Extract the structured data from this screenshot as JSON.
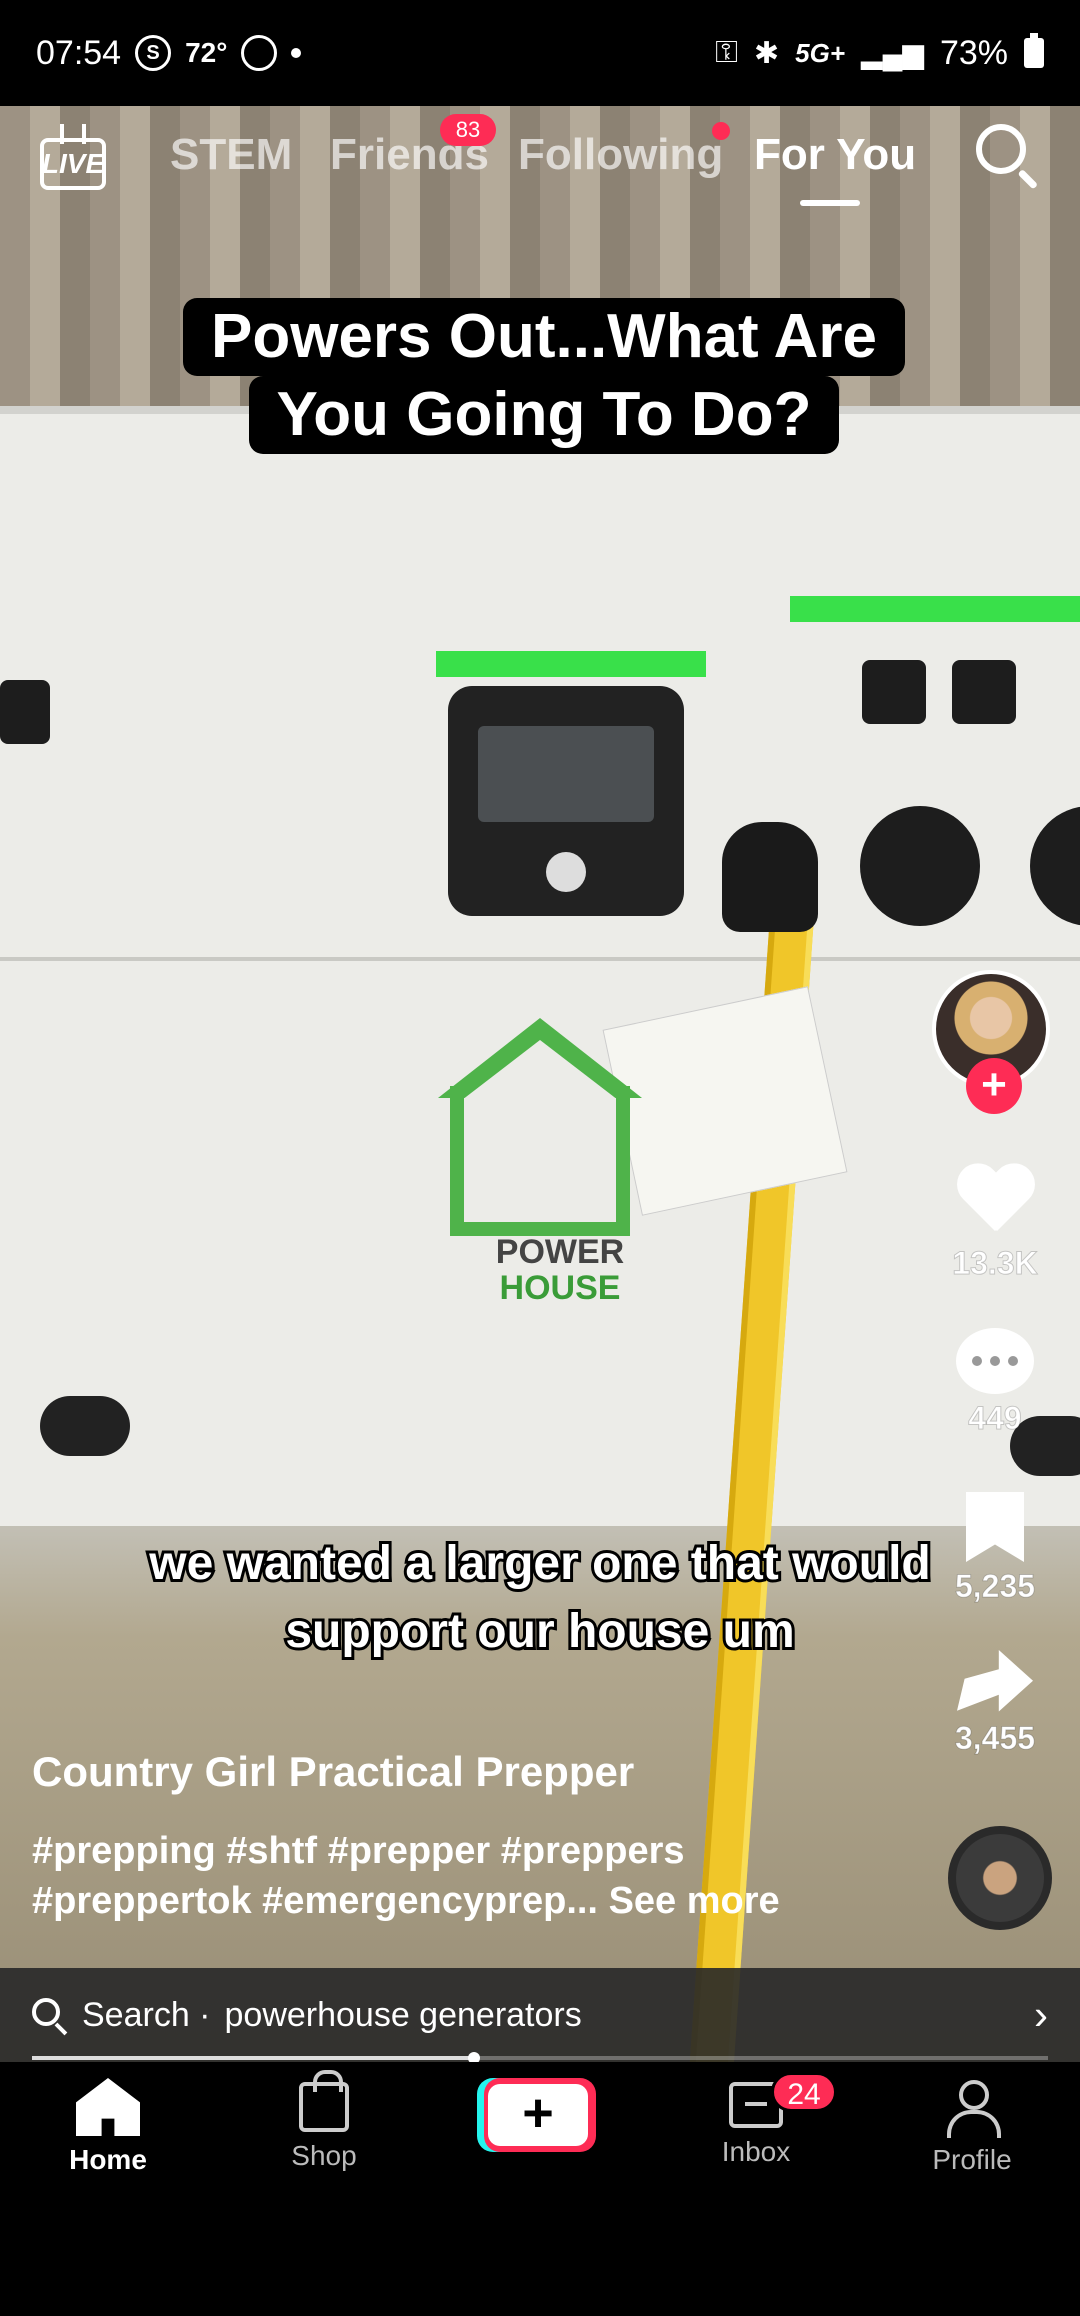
{
  "status_bar": {
    "time": "07:54",
    "s_icon": "S",
    "temperature": "72°",
    "network": "5G+",
    "battery": "73%"
  },
  "top_nav": {
    "live_label": "LIVE",
    "tabs": [
      {
        "label": "STEM"
      },
      {
        "label": "Friends",
        "badge": "83"
      },
      {
        "label": "Following"
      },
      {
        "label": "For You",
        "active": true
      }
    ]
  },
  "video": {
    "title_line1": "Powers Out...What Are",
    "title_line2": "You Going To Do?",
    "caption_line1": "we wanted a larger one that would",
    "caption_line2": "support our house um",
    "product_logo_line1": "POWER",
    "product_logo_line2": "HOUSE"
  },
  "rail": {
    "likes": "13.3K",
    "comments": "449",
    "saves": "5,235",
    "shares": "3,455"
  },
  "post": {
    "creator": "Country Girl Practical Prepper",
    "desc_line1": "#prepping #shtf #prepper #preppers",
    "desc_line2": "#preppertok #emergencyprep...",
    "see_more": "See more"
  },
  "suggestion": {
    "prefix": "Search ·",
    "query": "powerhouse generators"
  },
  "playback": {
    "progress": 0.435
  },
  "bottom_nav": {
    "home": "Home",
    "shop": "Shop",
    "create": "+",
    "inbox": "Inbox",
    "inbox_badge": "24",
    "profile": "Profile"
  },
  "colors": {
    "accent": "#fe2c55",
    "accent_alt": "#25f4ee"
  }
}
